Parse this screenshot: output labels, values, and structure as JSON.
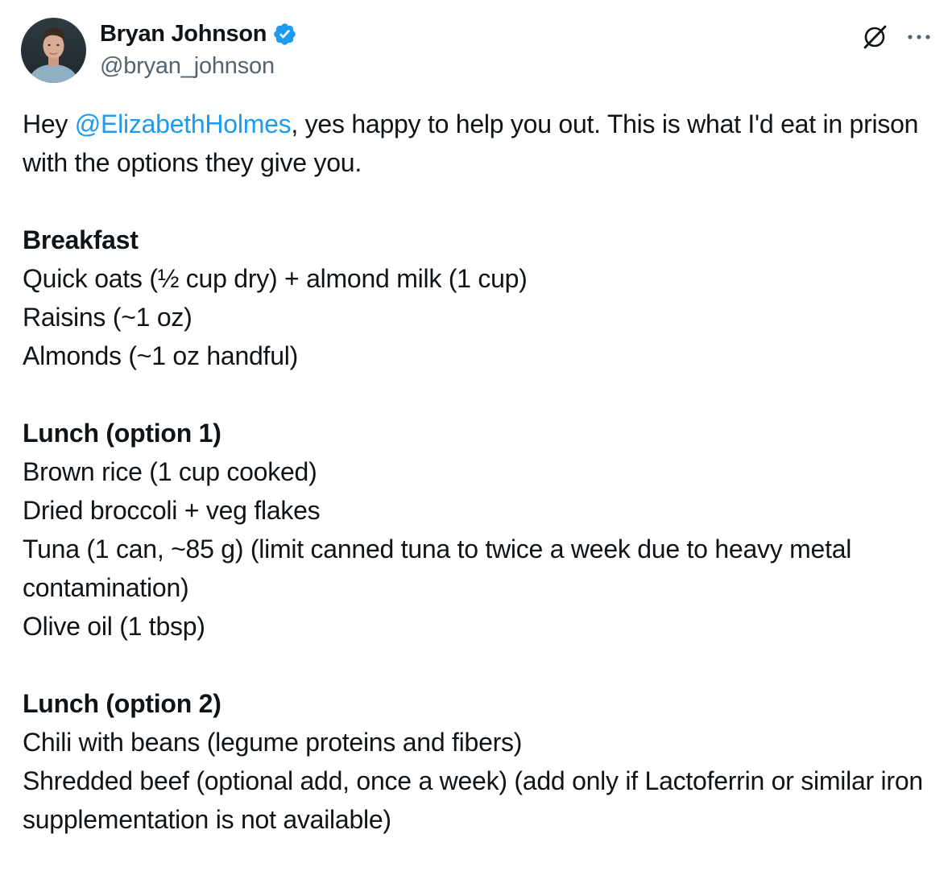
{
  "author": {
    "display_name": "Bryan Johnson",
    "handle": "@bryan_johnson",
    "verified": true,
    "verified_icon": "verified-badge-icon",
    "verified_color": "#1d9bf0"
  },
  "actions": {
    "grok_icon": "grok-icon",
    "more_icon": "more-icon"
  },
  "tweet": {
    "intro_prefix": "Hey ",
    "mention": "@ElizabethHolmes",
    "intro_suffix": ", yes happy to help you out. This is what I'd eat in prison with the options they give you.",
    "sections": [
      {
        "heading": "Breakfast",
        "items": [
          "Quick oats (½ cup dry) + almond milk (1 cup)",
          "Raisins (~1 oz)",
          "Almonds (~1 oz handful)"
        ]
      },
      {
        "heading": "Lunch (option 1)",
        "items": [
          "Brown rice (1 cup cooked)",
          "Dried broccoli + veg flakes",
          "Tuna (1 can, ~85 g) (limit canned tuna to twice a week due to heavy metal contamination)",
          "Olive oil (1 tbsp)"
        ]
      },
      {
        "heading": "Lunch (option 2)",
        "items": [
          "Chili with beans (legume proteins and fibers)",
          "Shredded beef (optional add, once a week) (add only if Lactoferrin or similar iron supplementation is not available)"
        ]
      }
    ]
  },
  "colors": {
    "text": "#0f1419",
    "secondary_text": "#536471",
    "link": "#1d9bf0"
  }
}
